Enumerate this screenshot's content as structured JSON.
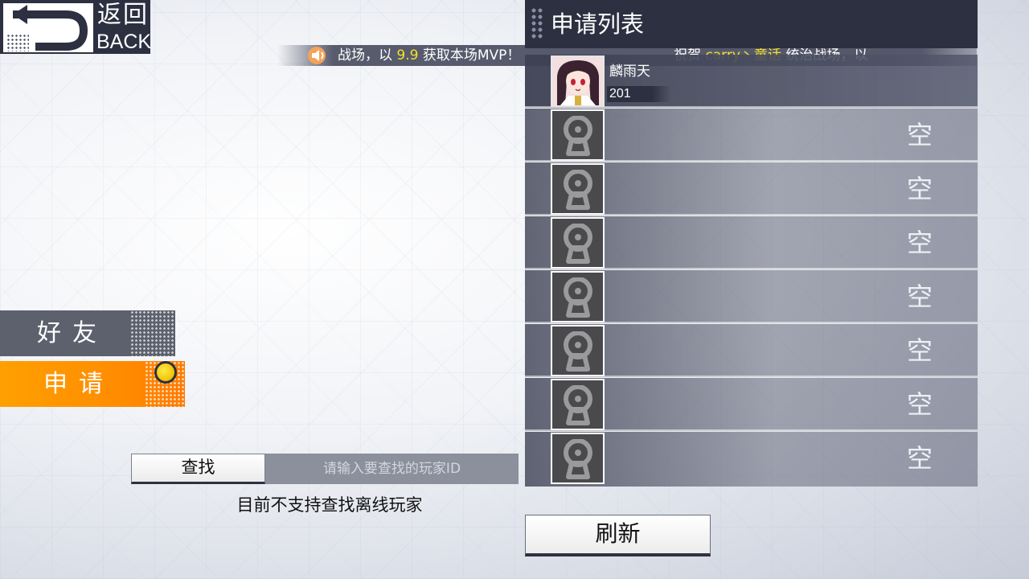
{
  "back": {
    "cn_label": "返回",
    "en_label": "BACK"
  },
  "ticker": {
    "icon": "speaker-icon",
    "msg1_part1": "战场，以 ",
    "msg1_value": "9.9",
    "msg1_part2": " 获取本场MVP！",
    "msg2_part1": "祝贺 ",
    "msg2_names": "carry丶童话",
    "msg2_part2": " 统治战场，以"
  },
  "tabs": {
    "friends": "好友",
    "apply": "申请"
  },
  "search": {
    "button_label": "查找",
    "placeholder": "请输入要查找的玩家ID",
    "note": "目前不支持查找离线玩家"
  },
  "panel": {
    "title": "申请列表",
    "rows": [
      {
        "name": "麟雨天",
        "level": "201"
      },
      {
        "empty_label": "空"
      },
      {
        "empty_label": "空"
      },
      {
        "empty_label": "空"
      },
      {
        "empty_label": "空"
      },
      {
        "empty_label": "空"
      },
      {
        "empty_label": "空"
      },
      {
        "empty_label": "空"
      }
    ]
  },
  "refresh": {
    "label": "刷新"
  },
  "colors": {
    "accent": "#ff9200",
    "panel_dark": "#2d3040",
    "highlight": "#f5e02a"
  }
}
